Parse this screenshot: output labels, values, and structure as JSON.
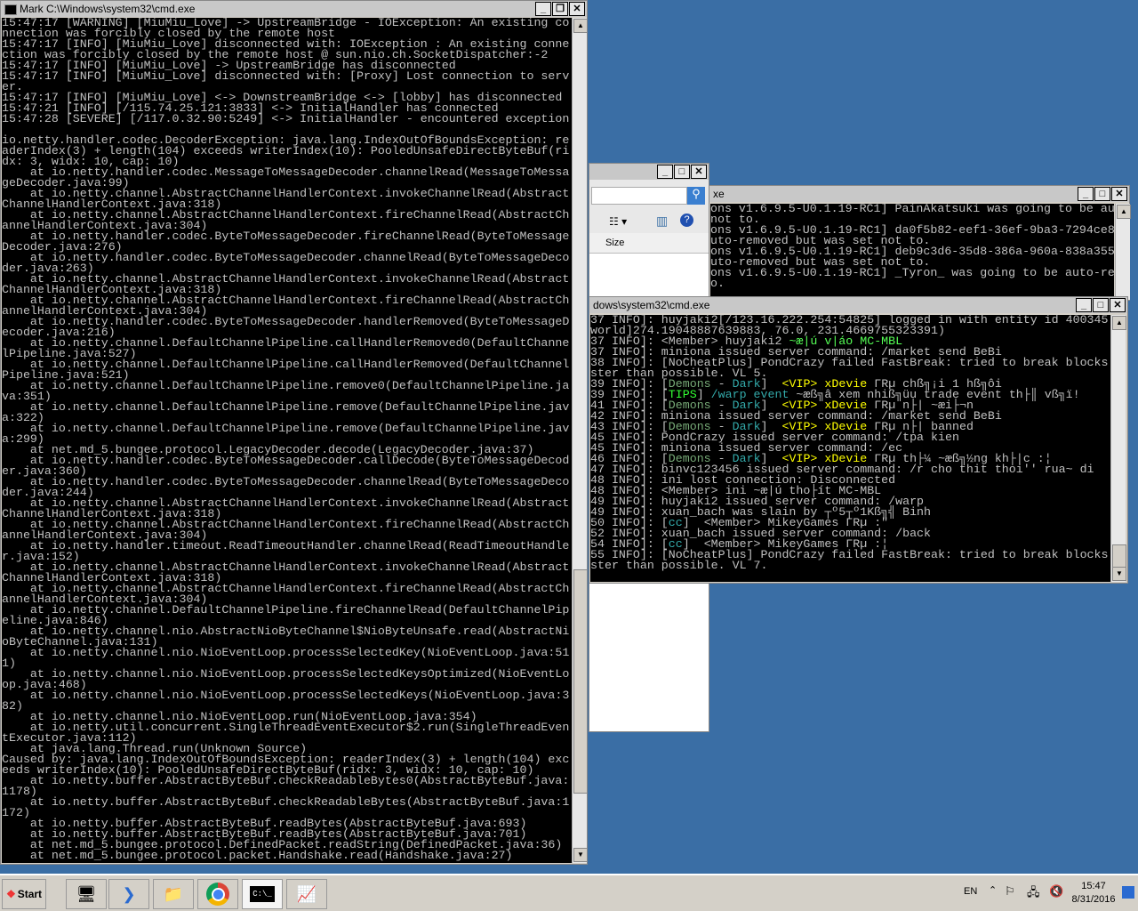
{
  "main_window": {
    "title": "Mark C:\\Windows\\system32\\cmd.exe",
    "lines": [
      "15:47:17 [WARNING] [MiuMiu_Love] -> UpstreamBridge - IOException: An existing co",
      "nnection was forcibly closed by the remote host",
      "15:47:17 [INFO] [MiuMiu_Love] disconnected with: IOException : An existing conne",
      "ction was forcibly closed by the remote host @ sun.nio.ch.SocketDispatcher:-2",
      "15:47:17 [INFO] [MiuMiu_Love] -> UpstreamBridge has disconnected",
      "15:47:17 [INFO] [MiuMiu_Love] disconnected with: [Proxy] Lost connection to serv",
      "er.",
      "15:47:17 [INFO] [MiuMiu_Love] <-> DownstreamBridge <-> [lobby] has disconnected",
      "15:47:21 [INFO] [/115.74.25.121:3833] <-> InitialHandler has connected",
      "15:47:28 [SEVERE] [/117.0.32.90:5249] <-> InitialHandler - encountered exception",
      "",
      "io.netty.handler.codec.DecoderException: java.lang.IndexOutOfBoundsException: re",
      "aderIndex(3) + length(104) exceeds writerIndex(10): PooledUnsafeDirectByteBuf(ri",
      "dx: 3, widx: 10, cap: 10)",
      "    at io.netty.handler.codec.MessageToMessageDecoder.channelRead(MessageToMessa",
      "geDecoder.java:99)",
      "    at io.netty.channel.AbstractChannelHandlerContext.invokeChannelRead(Abstract",
      "ChannelHandlerContext.java:318)",
      "    at io.netty.channel.AbstractChannelHandlerContext.fireChannelRead(AbstractCh",
      "annelHandlerContext.java:304)",
      "    at io.netty.handler.codec.ByteToMessageDecoder.fireChannelRead(ByteToMessage",
      "Decoder.java:276)",
      "    at io.netty.handler.codec.ByteToMessageDecoder.channelRead(ByteToMessageDeco",
      "der.java:263)",
      "    at io.netty.channel.AbstractChannelHandlerContext.invokeChannelRead(Abstract",
      "ChannelHandlerContext.java:318)",
      "    at io.netty.channel.AbstractChannelHandlerContext.fireChannelRead(AbstractCh",
      "annelHandlerContext.java:304)",
      "    at io.netty.handler.codec.ByteToMessageDecoder.handlerRemoved(ByteToMessageD",
      "ecoder.java:216)",
      "    at io.netty.channel.DefaultChannelPipeline.callHandlerRemoved0(DefaultChanne",
      "lPipeline.java:527)",
      "    at io.netty.channel.DefaultChannelPipeline.callHandlerRemoved(DefaultChannel",
      "Pipeline.java:521)",
      "    at io.netty.channel.DefaultChannelPipeline.remove0(DefaultChannelPipeline.ja",
      "va:351)",
      "    at io.netty.channel.DefaultChannelPipeline.remove(DefaultChannelPipeline.jav",
      "a:322)",
      "    at io.netty.channel.DefaultChannelPipeline.remove(DefaultChannelPipeline.jav",
      "a:299)",
      "    at net.md_5.bungee.protocol.LegacyDecoder.decode(LegacyDecoder.java:37)",
      "    at io.netty.handler.codec.ByteToMessageDecoder.callDecode(ByteToMessageDecod",
      "er.java:360)",
      "    at io.netty.handler.codec.ByteToMessageDecoder.channelRead(ByteToMessageDeco",
      "der.java:244)",
      "    at io.netty.channel.AbstractChannelHandlerContext.invokeChannelRead(Abstract",
      "ChannelHandlerContext.java:318)",
      "    at io.netty.channel.AbstractChannelHandlerContext.fireChannelRead(AbstractCh",
      "annelHandlerContext.java:304)",
      "    at io.netty.handler.timeout.ReadTimeoutHandler.channelRead(ReadTimeoutHandle",
      "r.java:152)",
      "    at io.netty.channel.AbstractChannelHandlerContext.invokeChannelRead(Abstract",
      "ChannelHandlerContext.java:318)",
      "    at io.netty.channel.AbstractChannelHandlerContext.fireChannelRead(AbstractCh",
      "annelHandlerContext.java:304)",
      "    at io.netty.channel.DefaultChannelPipeline.fireChannelRead(DefaultChannelPip",
      "eline.java:846)",
      "    at io.netty.channel.nio.AbstractNioByteChannel$NioByteUnsafe.read(AbstractNi",
      "oByteChannel.java:131)",
      "    at io.netty.channel.nio.NioEventLoop.processSelectedKey(NioEventLoop.java:51",
      "1)",
      "    at io.netty.channel.nio.NioEventLoop.processSelectedKeysOptimized(NioEventLo",
      "op.java:468)",
      "    at io.netty.channel.nio.NioEventLoop.processSelectedKeys(NioEventLoop.java:3",
      "82)",
      "    at io.netty.channel.nio.NioEventLoop.run(NioEventLoop.java:354)",
      "    at io.netty.util.concurrent.SingleThreadEventExecutor$2.run(SingleThreadEven",
      "tExecutor.java:112)",
      "    at java.lang.Thread.run(Unknown Source)",
      "Caused by: java.lang.IndexOutOfBoundsException: readerIndex(3) + length(104) exc",
      "eeds writerIndex(10): PooledUnsafeDirectByteBuf(ridx: 3, widx: 10, cap: 10)",
      "    at io.netty.buffer.AbstractByteBuf.checkReadableBytes0(AbstractByteBuf.java:",
      "1178)",
      "    at io.netty.buffer.AbstractByteBuf.checkReadableBytes(AbstractByteBuf.java:1",
      "172)",
      "    at io.netty.buffer.AbstractByteBuf.readBytes(AbstractByteBuf.java:693)",
      "    at io.netty.buffer.AbstractByteBuf.readBytes(AbstractByteBuf.java:701)",
      "    at net.md_5.bungee.protocol.DefinedPacket.readString(DefinedPacket.java:36)",
      "    at net.md_5.bungee.protocol.packet.Handshake.read(Handshake.java:27)"
    ]
  },
  "explorer_window": {
    "column_size": "Size"
  },
  "window_a": {
    "title": "xe",
    "lines": [
      "ons v1.6.9.5-U0.1.19-RC1] PainAkatsuki was going to be au",
      "not to.",
      "ons v1.6.9.5-U0.1.19-RC1] da0f5b82-eef1-36ef-9ba3-7294ce8",
      "uto-removed but was set not to.",
      "ons v1.6.9.5-U0.1.19-RC1] deb9c3d6-35d8-386a-960a-838a355",
      "uto-removed but was set not to.",
      "ons v1.6.9.5-U0.1.19-RC1] _Tyron_ was going to be auto-re",
      "o."
    ]
  },
  "window_b": {
    "title": "dows\\system32\\cmd.exe",
    "lines": [
      "37 INFO]: huyjaki2[/123.16.222.254:54825] logged in with entity id 400345",
      "world]274.19048887639883, 76.0, 231.4669755323391)",
      "37 INFO]: <Member> huyjaki2 ~æ|ú v|áo MC-MBL",
      "37 INFO]: miniona issued server command: /market send BeBi",
      "38 INFO]: [NoCheatPlus] PondCrazy failed FastBreak: tried to break blocks",
      "ster than possible. VL 5.",
      "39 INFO]: [Demons - Dark]  <VIP> xDevie ΓRµ chß╗¡i 1 hß╗ôi",
      "39 INFO]: [TIPS] /warp event ~æß╗â xem nhiß╗üu trade event th├║ vß╗ï!",
      "41 INFO]: [Demons - Dark]  <VIP> xDevie ΓRµ n├| ~æi├¬n",
      "42 INFO]: miniona issued server command: /market send BeBi",
      "43 INFO]: [Demons - Dark]  <VIP> xDevie ΓRµ n├| banned",
      "45 INFO]: PondCrazy issued server command: /tpa kien",
      "45 INFO]: miniona issued server command: /ec",
      "46 INFO]: [Demons - Dark]  <VIP> xDevie ΓRµ th├¼ ~æß╗½ng kh├|c :¦",
      "47 INFO]: binvc123456 issued server command: /r cho thit thoi'' rua~ di",
      "48 INFO]: ini lost connection: Disconnected",
      "48 INFO]: <Member> ini ~æ|ú tho├ít MC-MBL",
      "49 INFO]: huyjaki2 issued server command: /warp",
      "49 INFO]: xuan_bach was slain by ┬º5┬º1Kß╗╣ Binh",
      "50 INFO]: [cc]  <Member> MikeyGames ΓRµ :\"",
      "52 INFO]: xuan_bach issued server command: /back",
      "54 INFO]: [cc]  <Member> MikeyGames ΓRµ :¦",
      "55 INFO]: [NoCheatPlus] PondCrazy failed FastBreak: tried to break blocks",
      "ster than possible. VL 7."
    ]
  },
  "taskbar": {
    "start": "Start",
    "lang": "EN",
    "time": "15:47",
    "date": "8/31/2016"
  }
}
